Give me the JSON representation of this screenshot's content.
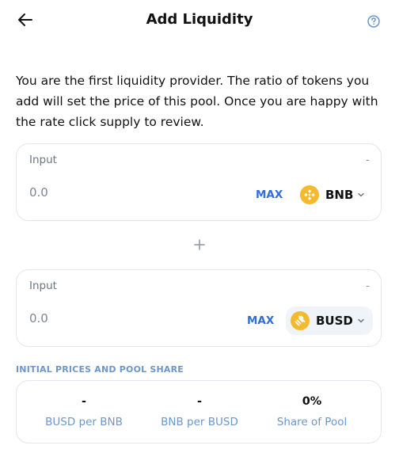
{
  "header": {
    "title": "Add Liquidity",
    "back_icon": "arrow-left-icon",
    "help_icon": "question-circle-icon"
  },
  "intro_text": "You are the first liquidity provider. The ratio of tokens you add will set the price of this pool. Once you are happy with the rate click supply to review.",
  "inputs": [
    {
      "label": "Input",
      "balance": "-",
      "placeholder": "0.0",
      "max_label": "MAX",
      "token": "BNB",
      "token_icon": "bnb-icon"
    },
    {
      "label": "Input",
      "balance": "-",
      "placeholder": "0.0",
      "max_label": "MAX",
      "token": "BUSD",
      "token_icon": "busd-icon"
    }
  ],
  "separator_icon": "plus-icon",
  "prices": {
    "section_title": "INITIAL PRICES AND POOL SHARE",
    "items": [
      {
        "value": "-",
        "label": "BUSD per BNB"
      },
      {
        "value": "-",
        "label": "BNB per BUSD"
      },
      {
        "value": "0%",
        "label": "Share of Pool"
      }
    ]
  },
  "colors": {
    "accent": "#2f6fd6",
    "label_blue": "#6d96c9",
    "token_yellow": "#f3ba2f",
    "border": "#e3e6ec"
  }
}
